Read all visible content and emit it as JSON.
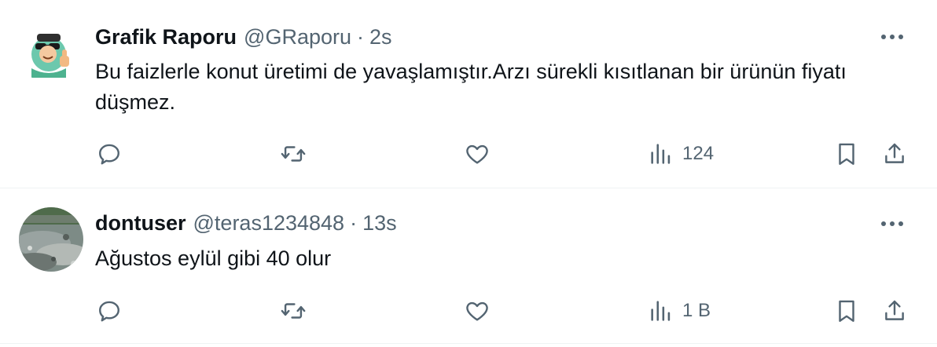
{
  "tweets": [
    {
      "display_name": "Grafik Raporu",
      "handle": "@GRaporu",
      "separator": "·",
      "time": "2s",
      "text": "Bu faizlerle konut üretimi de yavaşlamıştır.Arzı sürekli kısıtlanan bir ürünün fiyatı düşmez.",
      "views": "124",
      "avatar_icon": "cartoon-thumbs-up-avatar"
    },
    {
      "display_name": "dontuser",
      "handle": "@teras1234848",
      "separator": "·",
      "time": "13s",
      "text": "Ağustos eylül gibi 40 olur",
      "views": "1 B",
      "avatar_icon": "rocky-landscape-photo-avatar"
    }
  ],
  "icons": {
    "more": "more-icon",
    "reply": "reply-icon",
    "retweet": "retweet-icon",
    "like": "like-icon",
    "views": "views-icon",
    "bookmark": "bookmark-icon",
    "share": "share-icon"
  },
  "colors": {
    "text_primary": "#0f1419",
    "text_secondary": "#536471",
    "divider": "#eff3f4"
  }
}
